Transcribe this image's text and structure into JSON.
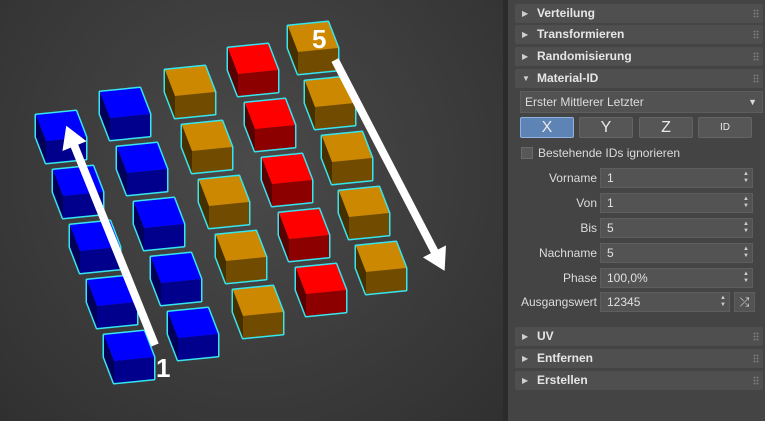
{
  "viewport": {
    "arrow_start_label": "1",
    "arrow_end_label": "5",
    "colors": {
      "blue": "#0000ff",
      "orange": "#cc8800",
      "red": "#ff0000",
      "selection": "#35e6f0",
      "arrow": "#ffffff"
    }
  },
  "rollouts_top": [
    {
      "label": "Verteilung",
      "state": "collapsed"
    },
    {
      "label": "Transformieren",
      "state": "collapsed"
    },
    {
      "label": "Randomisierung",
      "state": "collapsed"
    },
    {
      "label": "Material-ID",
      "state": "expanded"
    }
  ],
  "material_id": {
    "mode_select": "Erster Mittlerer Letzter",
    "axis_buttons": [
      "X",
      "Y",
      "Z",
      "ID"
    ],
    "active_axis": "X",
    "ignore_existing_label": "Bestehende IDs ignorieren",
    "ignore_existing_checked": false,
    "fields": [
      {
        "label": "Vorname",
        "value": "1"
      },
      {
        "label": "Von",
        "value": "1"
      },
      {
        "label": "Bis",
        "value": "5"
      },
      {
        "label": "Nachname",
        "value": "5"
      },
      {
        "label": "Phase",
        "value": "100,0%"
      },
      {
        "label": "Ausgangswert",
        "value": "12345"
      }
    ],
    "shuffle_icon": "shuffle-icon"
  },
  "rollouts_bottom": [
    {
      "label": "UV",
      "state": "collapsed"
    },
    {
      "label": "Entfernen",
      "state": "collapsed"
    },
    {
      "label": "Erstellen",
      "state": "collapsed"
    }
  ],
  "panel_colors": {
    "panel_bg": "#444444",
    "rollout_bg": "#4f4f4f",
    "accent": "#5e83b5"
  }
}
